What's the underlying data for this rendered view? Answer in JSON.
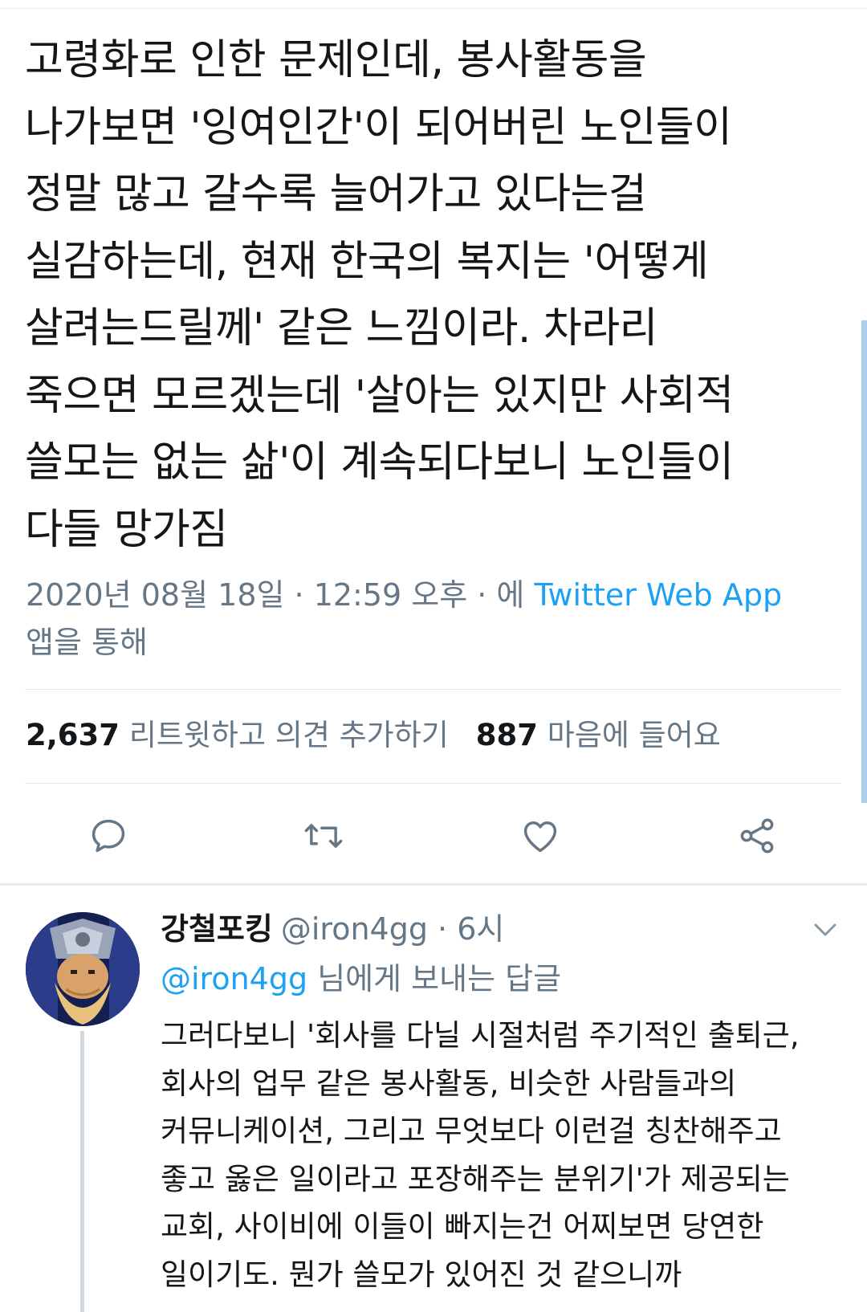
{
  "tweet": {
    "text_lines": [
      "고령화로 인한 문제인데, 봉사활동을",
      "나가보면 '잉여인간'이 되어버린 노인들이",
      "정말 많고 갈수록 늘어가고 있다는걸",
      "실감하는데, 현재 한국의 복지는 '어떻게",
      "살려는드릴께' 같은 느낌이라. 차라리",
      "죽으면 모르겠는데 '살아는 있지만 사회적",
      "쓸모는 없는 삶'이 계속되다보니 노인들이",
      "다들 망가짐"
    ],
    "meta_prefix": "2020년 08월 18일 · 12:59 오후 · 에 ",
    "source": "Twitter Web App",
    "meta_suffix": "앱을 통해",
    "retweet_count": "2,637",
    "retweet_label": "리트윗하고 의견 추가하기",
    "like_count": "887",
    "like_label": "마음에 들어요"
  },
  "actions": {
    "reply_icon": "reply-icon",
    "retweet_icon": "retweet-icon",
    "like_icon": "heart-icon",
    "share_icon": "share-icon"
  },
  "reply": {
    "name": "강철포킹",
    "handle": "@iron4gg",
    "time": "· 6시",
    "mention": "@iron4gg",
    "reply_to_label": "님에게 보내는 답글",
    "text_lines": [
      "그러다보니 '회사를 다닐 시절처럼 주기적인 출퇴근,",
      "회사의 업무 같은 봉사활동, 비슷한 사람들과의",
      "커뮤니케이션, 그리고 무엇보다 이런걸 칭찬해주고",
      "좋고 옳은 일이라고 포장해주는 분위기'가 제공되는",
      "교회, 사이비에 이들이 빠지는건 어찌보면 당연한",
      "일이기도. 뭔가 쓸모가 있어진 것 같으니까"
    ]
  },
  "colors": {
    "text": "#14171a",
    "secondary": "#657786",
    "accent": "#1da1f2",
    "divider": "#e1e8ed"
  }
}
